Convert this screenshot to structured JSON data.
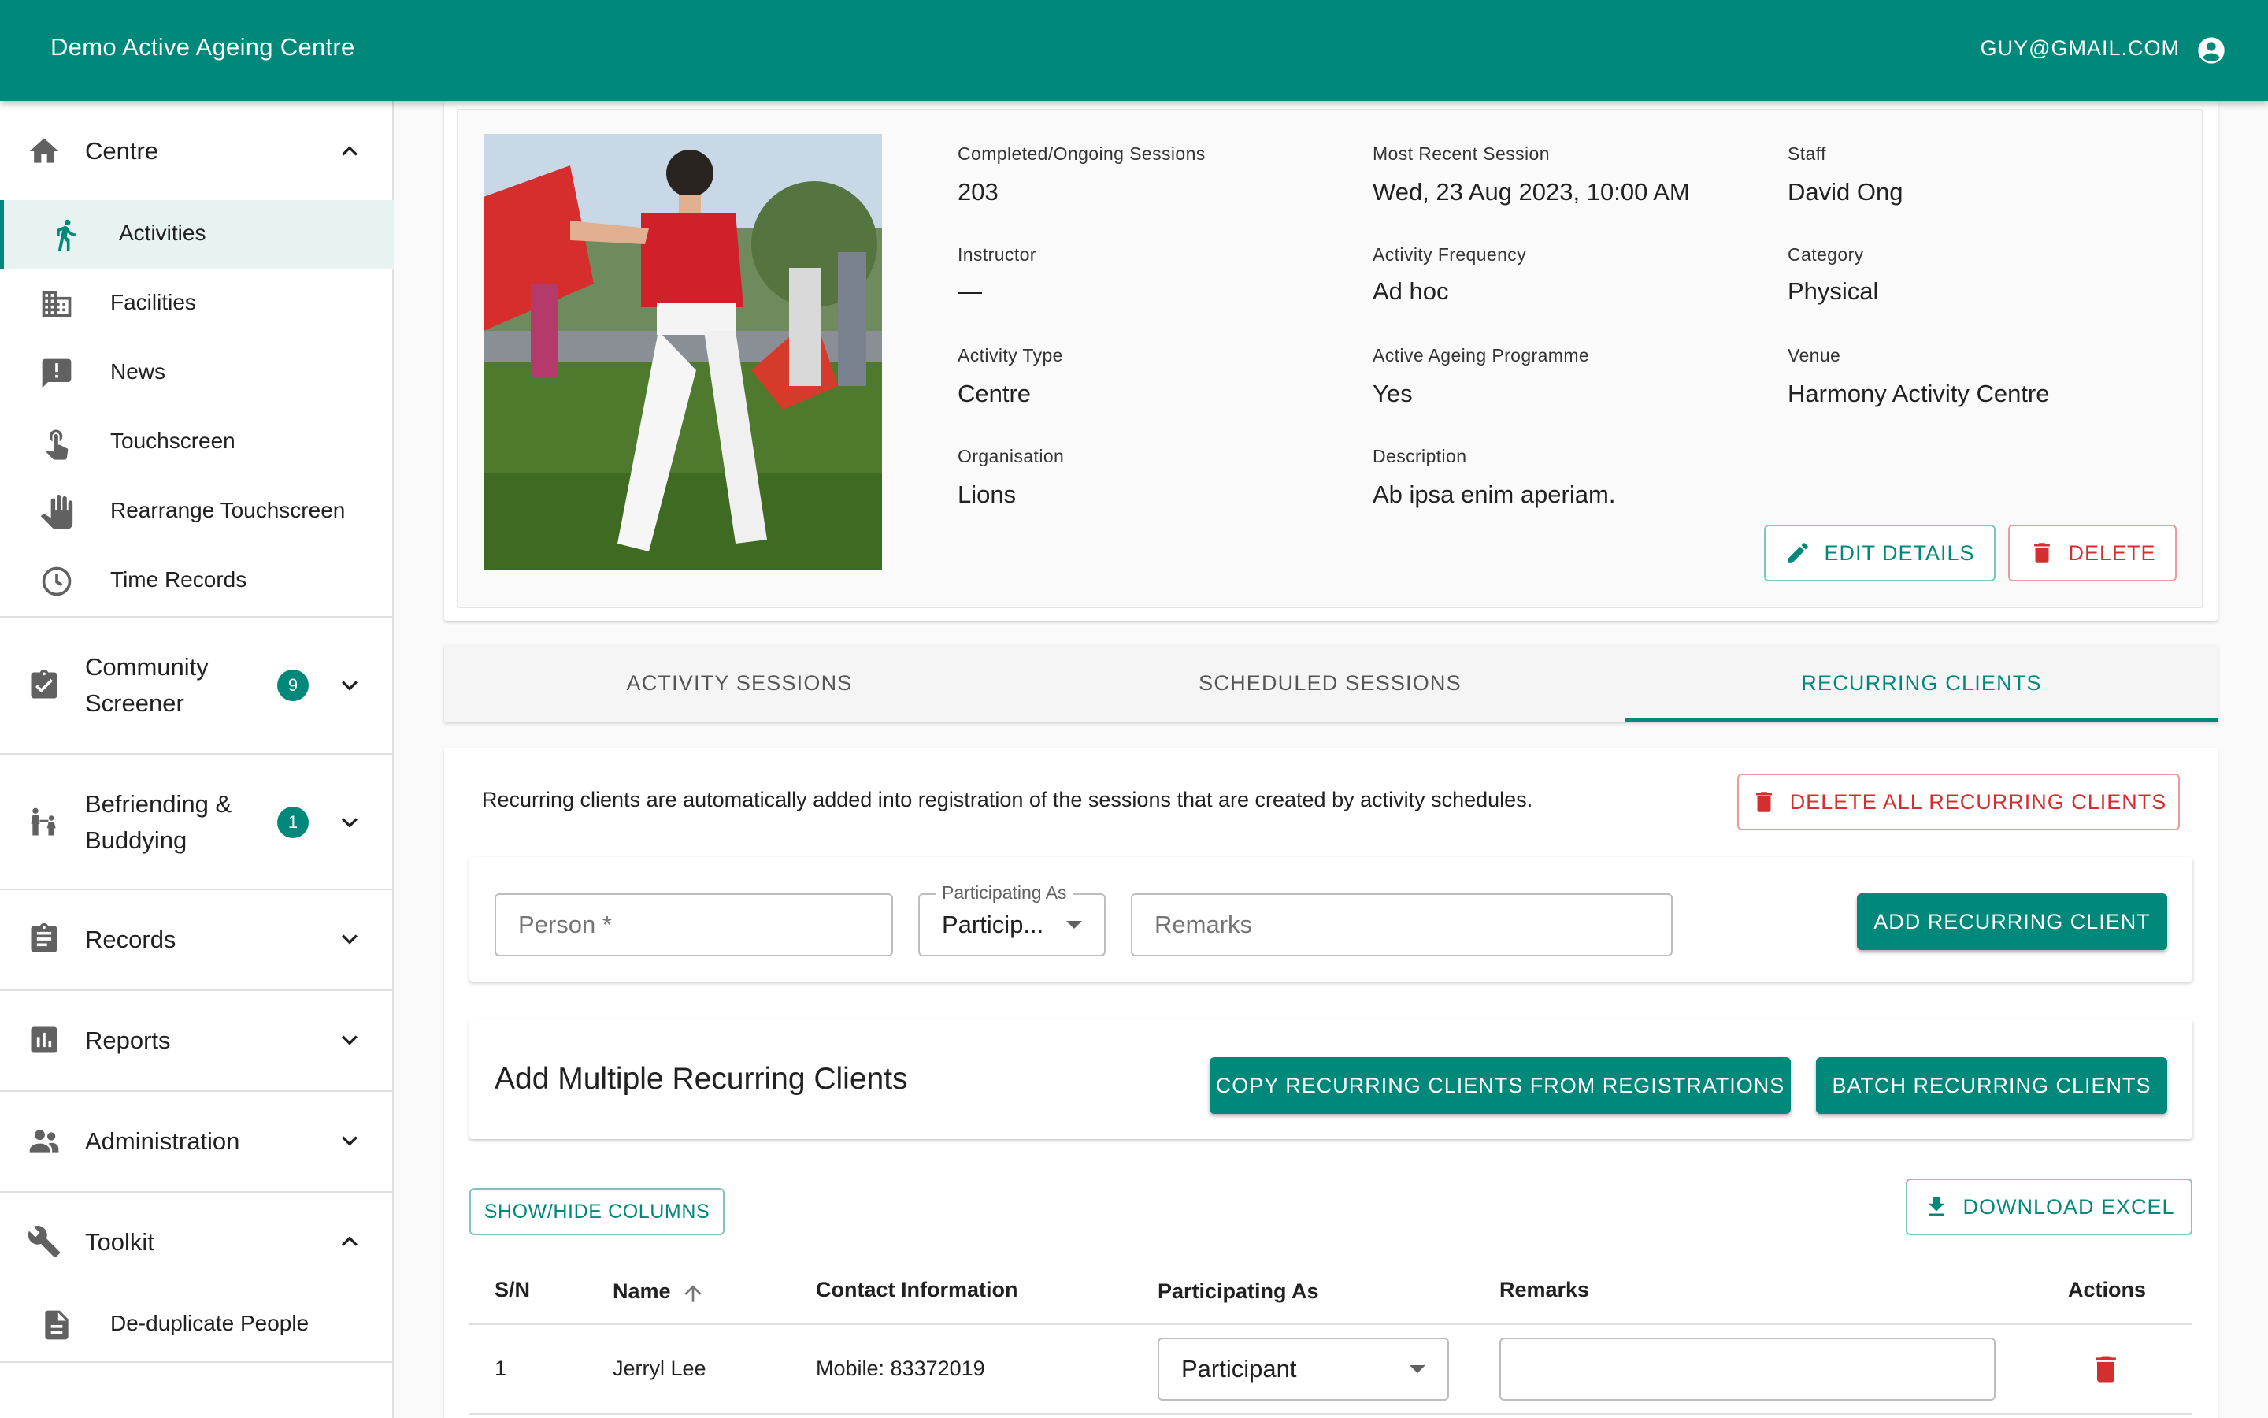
{
  "app": {
    "title": "Demo Active Ageing Centre",
    "user_email": "GUY@GMAIL.COM"
  },
  "sidebar": {
    "centre": {
      "label": "Centre",
      "items": [
        {
          "label": "Activities",
          "icon": "running-icon",
          "active": true
        },
        {
          "label": "Facilities",
          "icon": "building-icon"
        },
        {
          "label": "News",
          "icon": "announcement-icon"
        },
        {
          "label": "Touchscreen",
          "icon": "touch-icon"
        },
        {
          "label": "Rearrange Touchscreen",
          "icon": "hand-icon"
        },
        {
          "label": "Time Records",
          "icon": "clock-icon"
        }
      ]
    },
    "community_screener": {
      "label_line1": "Community",
      "label_line2": "Screener",
      "badge": "9"
    },
    "befriending": {
      "label_line1": "Befriending &",
      "label_line2": "Buddying",
      "badge": "1"
    },
    "records": {
      "label": "Records"
    },
    "reports": {
      "label": "Reports"
    },
    "administration": {
      "label": "Administration"
    },
    "toolkit": {
      "label": "Toolkit",
      "items": [
        {
          "label": "De-duplicate People",
          "icon": "document-icon"
        }
      ]
    }
  },
  "details": {
    "completed_sessions": {
      "label": "Completed/Ongoing Sessions",
      "value": "203"
    },
    "recent_session": {
      "label": "Most Recent Session",
      "value": "Wed, 23 Aug 2023, 10:00 AM"
    },
    "staff": {
      "label": "Staff",
      "value": "David Ong"
    },
    "instructor": {
      "label": "Instructor",
      "value": "—"
    },
    "frequency": {
      "label": "Activity Frequency",
      "value": "Ad hoc"
    },
    "category": {
      "label": "Category",
      "value": "Physical"
    },
    "activity_type": {
      "label": "Activity Type",
      "value": "Centre"
    },
    "aap": {
      "label": "Active Ageing Programme",
      "value": "Yes"
    },
    "venue": {
      "label": "Venue",
      "value": "Harmony Activity Centre"
    },
    "organisation": {
      "label": "Organisation",
      "value": "Lions"
    },
    "description": {
      "label": "Description",
      "value": "Ab ipsa enim aperiam."
    },
    "edit_label": "EDIT DETAILS",
    "delete_label": "DELETE"
  },
  "tabs": [
    {
      "label": "ACTIVITY SESSIONS"
    },
    {
      "label": "SCHEDULED SESSIONS"
    },
    {
      "label": "RECURRING CLIENTS",
      "active": true
    }
  ],
  "recurring": {
    "info": "Recurring clients are automatically added into registration of the sessions that are created by activity schedules.",
    "delete_all_label": "DELETE ALL RECURRING CLIENTS",
    "person_placeholder": "Person *",
    "participating_legend": "Participating As",
    "participating_value": "Particip...",
    "remarks_placeholder": "Remarks",
    "add_label": "ADD RECURRING CLIENT",
    "multi_title": "Add Multiple Recurring Clients",
    "copy_label": "COPY RECURRING CLIENTS FROM REGISTRATIONS",
    "batch_label": "BATCH RECURRING CLIENTS",
    "show_hide_label": "SHOW/HIDE COLUMNS",
    "download_label": "DOWNLOAD EXCEL"
  },
  "table": {
    "headers": {
      "sn": "S/N",
      "name": "Name",
      "contact": "Contact Information",
      "participating": "Participating As",
      "remarks": "Remarks",
      "actions": "Actions"
    },
    "rows": [
      {
        "sn": "1",
        "name": "Jerryl Lee",
        "contact": "Mobile: 83372019",
        "participating": "Participant",
        "remarks": ""
      }
    ]
  },
  "colors": {
    "primary": "#00897b",
    "danger": "#d32f2f",
    "active_bg": "#e8f3f1"
  }
}
